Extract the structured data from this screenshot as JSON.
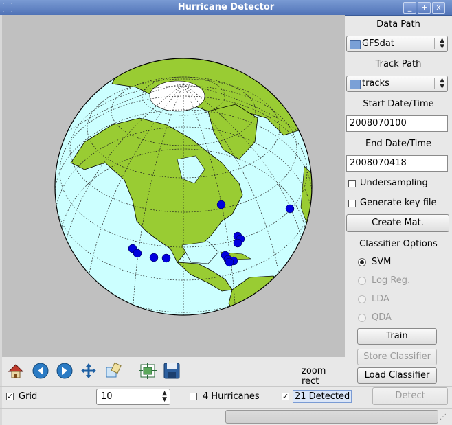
{
  "window": {
    "title": "Hurricane Detector",
    "buttons": [
      "_",
      "+",
      "x"
    ]
  },
  "sidebar": {
    "data_path_label": "Data Path",
    "data_path_value": "GFSdat",
    "track_path_label": "Track Path",
    "track_path_value": "tracks",
    "start_label": "Start Date/Time",
    "start_value": "2008070100",
    "end_label": "End Date/Time",
    "end_value": "2008070418",
    "undersampling_label": "Undersampling",
    "undersampling_checked": false,
    "keyfile_label": "Generate key file",
    "keyfile_checked": false,
    "create_mat_label": "Create Mat.",
    "classifier_options_label": "Classifier Options",
    "classifiers": [
      {
        "label": "SVM",
        "selected": true,
        "enabled": true
      },
      {
        "label": "Log Reg.",
        "selected": false,
        "enabled": false
      },
      {
        "label": "LDA",
        "selected": false,
        "enabled": false
      },
      {
        "label": "QDA",
        "selected": false,
        "enabled": false
      }
    ],
    "train_label": "Train",
    "store_label": "Store Classifier",
    "load_label": "Load Classifier"
  },
  "toolbar": {
    "icons": [
      "home-icon",
      "back-icon",
      "forward-icon",
      "pan-icon",
      "zoom-icon",
      "configure-subplots-icon",
      "save-icon"
    ],
    "mode_text": "zoom rect"
  },
  "bottom": {
    "grid_label": "Grid",
    "grid_checked": true,
    "spin_value": "10",
    "hurricanes_label": "4 Hurricanes",
    "hurricanes_checked": false,
    "detected_label": "21 Detected",
    "detected_checked": true,
    "detect_label": "Detect"
  },
  "colors": {
    "ocean": "#ccffff",
    "land": "#99cc33",
    "ice": "#ffffff",
    "detection": "#0000dd",
    "background": "#c0c0c0"
  }
}
